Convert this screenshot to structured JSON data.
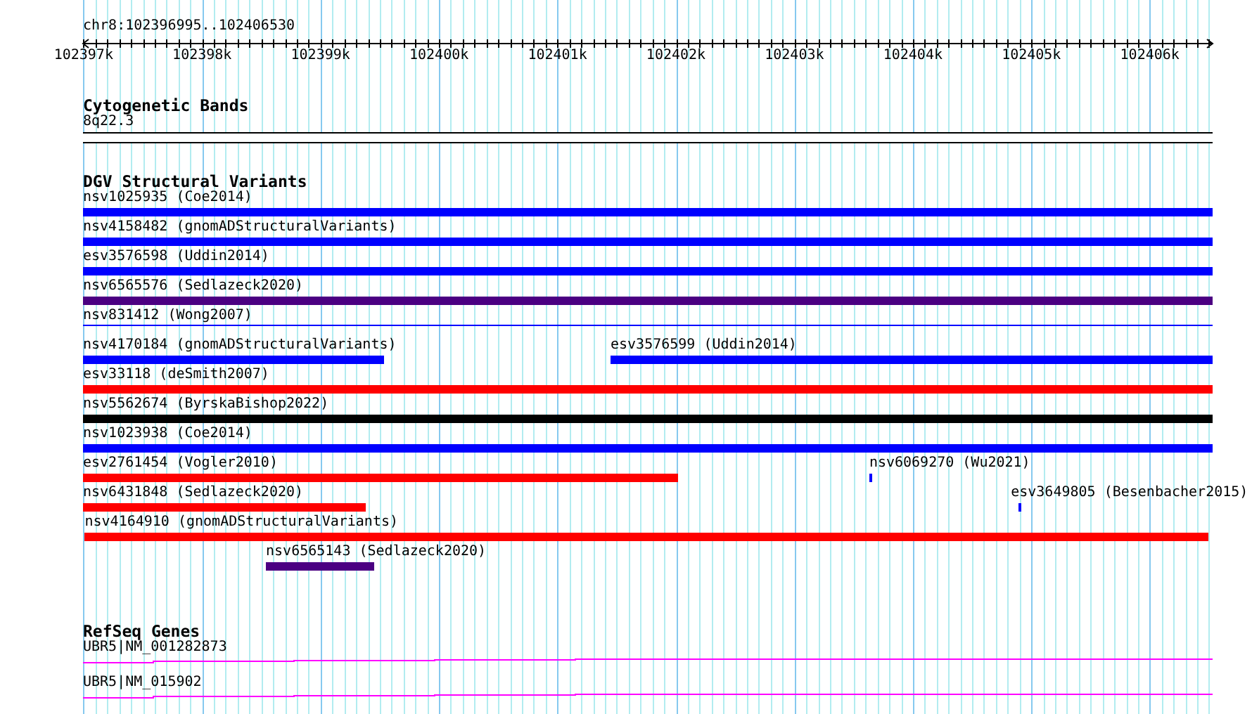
{
  "view": {
    "location": "chr8:102396995..102406530",
    "ticks": [
      "102397k",
      "102398k",
      "102399k",
      "102400k",
      "102401k",
      "102402k",
      "102403k",
      "102404k",
      "102405k",
      "102406k"
    ]
  },
  "cytogenetic_bands": {
    "title": "Cytogenetic Bands",
    "band": "8q22.3"
  },
  "dgv_structural_variants": {
    "title": "DGV Structural Variants",
    "rows": [
      [
        {
          "label": "nsv1025935 (Coe2014)",
          "color": "#0000ff",
          "kind": "bar"
        }
      ],
      [
        {
          "label": "nsv4158482 (gnomADStructuralVariants)",
          "color": "#0000ff",
          "kind": "bar"
        }
      ],
      [
        {
          "label": "esv3576598 (Uddin2014)",
          "color": "#0000ff",
          "kind": "bar"
        }
      ],
      [
        {
          "label": "nsv6565576 (Sedlazeck2020)",
          "color": "#4b0082",
          "kind": "bar"
        }
      ],
      [
        {
          "label": "nsv831412 (Wong2007)",
          "color": "#0000ff",
          "kind": "line"
        }
      ],
      [
        {
          "label": "nsv4170184 (gnomADStructuralVariants)",
          "color": "#0000ff",
          "kind": "bar"
        },
        {
          "label": "esv3576599 (Uddin2014)",
          "color": "#0000ff",
          "kind": "bar"
        }
      ],
      [
        {
          "label": "esv33118 (deSmith2007)",
          "color": "#ff0000",
          "kind": "bar"
        }
      ],
      [
        {
          "label": "nsv5562674 (ByrskaBishop2022)",
          "color": "#000000",
          "kind": "bar"
        }
      ],
      [
        {
          "label": "nsv1023938 (Coe2014)",
          "color": "#0000ff",
          "kind": "bar"
        }
      ],
      [
        {
          "label": "esv2761454 (Vogler2010)",
          "color": "#ff0000",
          "kind": "bar"
        },
        {
          "label": "nsv6069270 (Wu2021)",
          "color": "#0000ff",
          "kind": "bar"
        }
      ],
      [
        {
          "label": "nsv6431848 (Sedlazeck2020)",
          "color": "#ff0000",
          "kind": "bar"
        },
        {
          "label": "esv3649805 (Besenbacher2015)",
          "color": "#0000ff",
          "kind": "bar"
        }
      ],
      [
        {
          "label": "nsv4164910 (gnomADStructuralVariants)",
          "color": "#ff0000",
          "kind": "bar"
        }
      ],
      [
        {
          "label": "nsv6565143 (Sedlazeck2020)",
          "color": "#4b0082",
          "kind": "bar"
        }
      ]
    ]
  },
  "refseq_genes": {
    "title": "RefSeq Genes",
    "transcripts": [
      {
        "label": "UBR5|NM_001282873",
        "color": "#ff00ff"
      },
      {
        "label": "UBR5|NM_015902",
        "color": "#ff00ff"
      }
    ]
  }
}
